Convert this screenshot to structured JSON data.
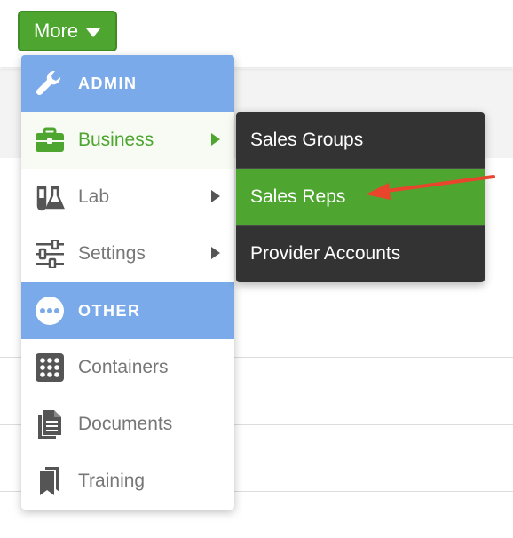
{
  "more_button": {
    "label": "More",
    "icon": "caret-down-icon"
  },
  "menu": {
    "items": [
      {
        "type": "header",
        "label": "ADMIN",
        "icon": "wrench-icon"
      },
      {
        "type": "item",
        "label": "Business",
        "icon": "briefcase-icon",
        "has_submenu": true,
        "active": true
      },
      {
        "type": "item",
        "label": "Lab",
        "icon": "lab-flasks-icon",
        "has_submenu": true
      },
      {
        "type": "item",
        "label": "Settings",
        "icon": "sliders-icon",
        "has_submenu": true
      },
      {
        "type": "header",
        "label": "OTHER",
        "icon": "ellipsis-circle-icon"
      },
      {
        "type": "item",
        "label": "Containers",
        "icon": "grid-icon"
      },
      {
        "type": "item",
        "label": "Documents",
        "icon": "documents-icon"
      },
      {
        "type": "item",
        "label": "Training",
        "icon": "bookmark-icon"
      }
    ]
  },
  "submenu": {
    "items": [
      {
        "label": "Sales Groups"
      },
      {
        "label": "Sales Reps",
        "selected": true
      },
      {
        "label": "Provider Accounts"
      }
    ]
  },
  "colors": {
    "accent_green": "#4ea631",
    "header_blue": "#7aaae9",
    "submenu_dark": "#333333",
    "annotation_red": "#e8452c"
  }
}
